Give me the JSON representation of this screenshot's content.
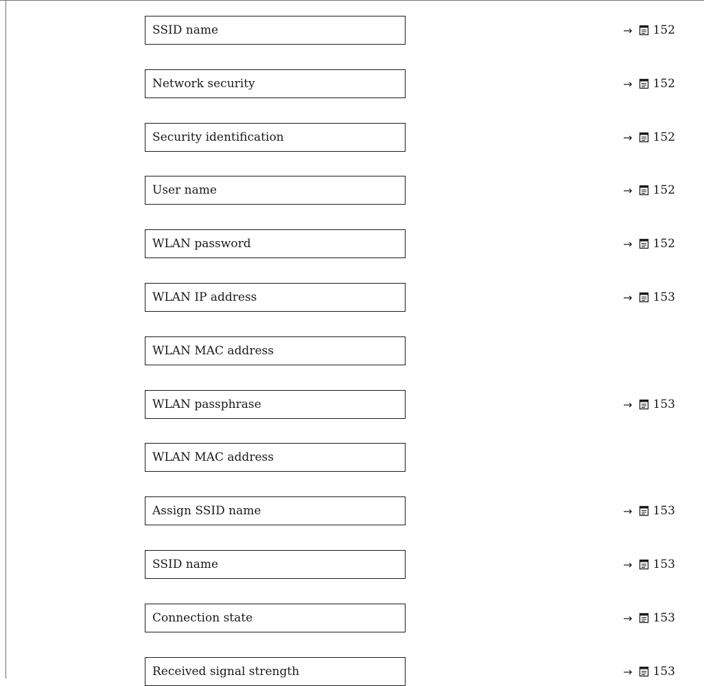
{
  "rows": [
    {
      "label": "SSID name",
      "has_ref": true,
      "page": "152"
    },
    {
      "label": "Network security",
      "has_ref": true,
      "page": "152"
    },
    {
      "label": "Security identification",
      "has_ref": true,
      "page": "152"
    },
    {
      "label": "User name",
      "has_ref": true,
      "page": "152"
    },
    {
      "label": "WLAN password",
      "has_ref": true,
      "page": "152"
    },
    {
      "label": "WLAN IP address",
      "has_ref": true,
      "page": "153"
    },
    {
      "label": "WLAN MAC address",
      "has_ref": false,
      "page": ""
    },
    {
      "label": "WLAN passphrase",
      "has_ref": true,
      "page": "153"
    },
    {
      "label": "WLAN MAC address",
      "has_ref": false,
      "page": ""
    },
    {
      "label": "Assign SSID name",
      "has_ref": true,
      "page": "153"
    },
    {
      "label": "SSID name",
      "has_ref": true,
      "page": "153"
    },
    {
      "label": "Connection state",
      "has_ref": true,
      "page": "153"
    },
    {
      "label": "Received signal strength",
      "has_ref": true,
      "page": "153"
    }
  ],
  "ref_arrow_symbol": "→",
  "ref_icon": "page-reference-icon"
}
